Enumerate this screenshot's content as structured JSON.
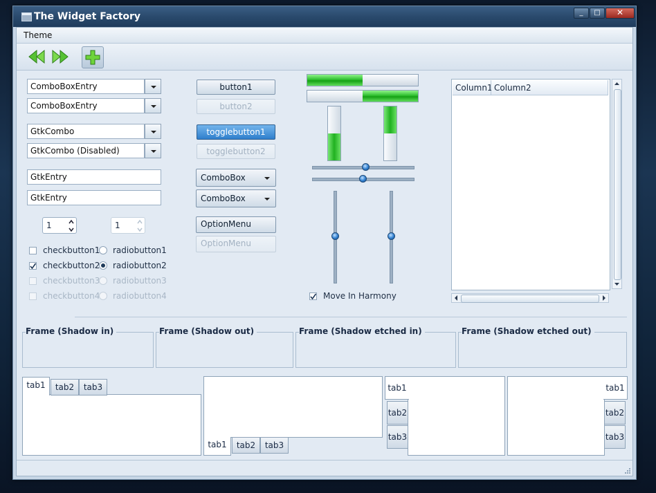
{
  "window": {
    "title": "The Widget Factory",
    "min": "_",
    "max": "□",
    "close": "✕"
  },
  "menu": {
    "theme": "Theme"
  },
  "toolbar": {
    "back_icon": "back-arrows-icon",
    "forward_icon": "forward-arrows-icon",
    "add_icon": "add-plus-icon"
  },
  "left": {
    "combo_entry_1": "ComboBoxEntry",
    "combo_entry_2": "ComboBoxEntry",
    "gtkcombo_1": "GtkCombo",
    "gtkcombo_2": "GtkCombo (Disabled)",
    "entry_1": "GtkEntry",
    "entry_2": "GtkEntry",
    "spin_1": "1",
    "spin_2": "1",
    "checks": [
      "checkbutton1",
      "checkbutton2",
      "checkbutton3",
      "checkbutton4"
    ],
    "radios": [
      "radiobutton1",
      "radiobutton2",
      "radiobutton3",
      "radiobutton4"
    ],
    "checked_check": "checkbutton2",
    "selected_radio": "radiobutton2"
  },
  "middle": {
    "button1": "button1",
    "button2": "button2",
    "toggle1": "togglebutton1",
    "toggle2": "togglebutton2",
    "combobox_1": "ComboBox",
    "combobox_2": "ComboBox",
    "optionmenu_1": "OptionMenu",
    "optionmenu_2": "OptionMenu"
  },
  "sliders": {
    "progress_h1": 0.5,
    "progress_h2": 0.5,
    "progress_v1": 0.5,
    "progress_v2": 0.5,
    "move_in_harmony": "Move In Harmony"
  },
  "tree": {
    "columns": [
      "Column1",
      "Column2"
    ]
  },
  "frames": [
    "Frame (Shadow in)",
    "Frame (Shadow out)",
    "Frame (Shadow etched in)",
    "Frame (Shadow etched out)"
  ],
  "notebooks": {
    "tabs": [
      "tab1",
      "tab2",
      "tab3"
    ]
  },
  "colors": {
    "accent": "#2f7fcc",
    "progress": "#2fbf2f",
    "titlebar": "#2a4a6d"
  }
}
